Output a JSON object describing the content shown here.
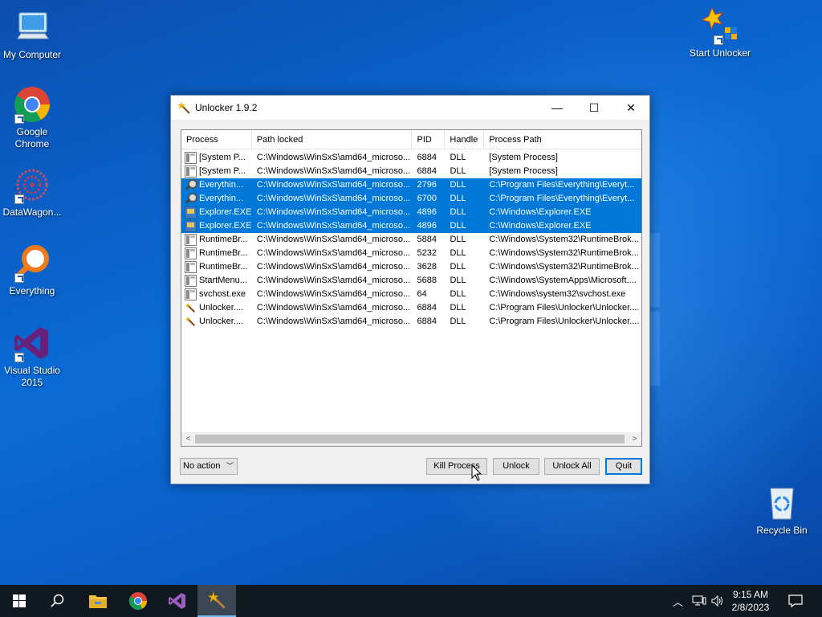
{
  "desktop": {
    "icons": [
      {
        "label": "My Computer"
      },
      {
        "label": "Google Chrome"
      },
      {
        "label": "DataWagon..."
      },
      {
        "label": "Everything"
      },
      {
        "label": "Visual Studio 2015"
      },
      {
        "label": "Start Unlocker"
      },
      {
        "label": "Recycle Bin"
      }
    ]
  },
  "window": {
    "title": "Unlocker 1.9.2",
    "controls": {
      "minimize": "—",
      "maximize": "☐",
      "close": "✕"
    },
    "columns": [
      "Process",
      "Path locked",
      "PID",
      "Handle",
      "Process Path"
    ],
    "rows": [
      {
        "process": "[System P...",
        "path": "C:\\Windows\\WinSxS\\amd64_microso...",
        "pid": "6884",
        "handle": "DLL",
        "ppath": "[System Process]",
        "icon": "process-icon",
        "selected": false
      },
      {
        "process": "[System P...",
        "path": "C:\\Windows\\WinSxS\\amd64_microso...",
        "pid": "6884",
        "handle": "DLL",
        "ppath": "[System Process]",
        "icon": "process-icon",
        "selected": false
      },
      {
        "process": "Everythin...",
        "path": "C:\\Windows\\WinSxS\\amd64_microso...",
        "pid": "2796",
        "handle": "DLL",
        "ppath": "C:\\Program Files\\Everything\\Everyt...",
        "icon": "magnifier-icon",
        "selected": true
      },
      {
        "process": "Everythin...",
        "path": "C:\\Windows\\WinSxS\\amd64_microso...",
        "pid": "6700",
        "handle": "DLL",
        "ppath": "C:\\Program Files\\Everything\\Everyt...",
        "icon": "magnifier-icon",
        "selected": true
      },
      {
        "process": "Explorer.EXE",
        "path": "C:\\Windows\\WinSxS\\amd64_microso...",
        "pid": "4896",
        "handle": "DLL",
        "ppath": "C:\\Windows\\Explorer.EXE",
        "icon": "explorer-icon",
        "selected": true
      },
      {
        "process": "Explorer.EXE",
        "path": "C:\\Windows\\WinSxS\\amd64_microso...",
        "pid": "4896",
        "handle": "DLL",
        "ppath": "C:\\Windows\\Explorer.EXE",
        "icon": "explorer-icon",
        "selected": true
      },
      {
        "process": "RuntimeBr...",
        "path": "C:\\Windows\\WinSxS\\amd64_microso...",
        "pid": "5884",
        "handle": "DLL",
        "ppath": "C:\\Windows\\System32\\RuntimeBrok...",
        "icon": "process-icon",
        "selected": false
      },
      {
        "process": "RuntimeBr...",
        "path": "C:\\Windows\\WinSxS\\amd64_microso...",
        "pid": "5232",
        "handle": "DLL",
        "ppath": "C:\\Windows\\System32\\RuntimeBrok...",
        "icon": "process-icon",
        "selected": false
      },
      {
        "process": "RuntimeBr...",
        "path": "C:\\Windows\\WinSxS\\amd64_microso...",
        "pid": "3628",
        "handle": "DLL",
        "ppath": "C:\\Windows\\System32\\RuntimeBrok...",
        "icon": "process-icon",
        "selected": false
      },
      {
        "process": "StartMenu...",
        "path": "C:\\Windows\\WinSxS\\amd64_microso...",
        "pid": "5688",
        "handle": "DLL",
        "ppath": "C:\\Windows\\SystemApps\\Microsoft....",
        "icon": "process-icon",
        "selected": false
      },
      {
        "process": "svchost.exe",
        "path": "C:\\Windows\\WinSxS\\amd64_microso...",
        "pid": "64",
        "handle": "DLL",
        "ppath": "C:\\Windows\\system32\\svchost.exe",
        "icon": "process-icon",
        "selected": false
      },
      {
        "process": "Unlocker....",
        "path": "C:\\Windows\\WinSxS\\amd64_microso...",
        "pid": "6884",
        "handle": "DLL",
        "ppath": "C:\\Program Files\\Unlocker\\Unlocker....",
        "icon": "wand-icon",
        "selected": false
      },
      {
        "process": "Unlocker....",
        "path": "C:\\Windows\\WinSxS\\amd64_microso...",
        "pid": "6884",
        "handle": "DLL",
        "ppath": "C:\\Program Files\\Unlocker\\Unlocker....",
        "icon": "wand-icon",
        "selected": false
      }
    ],
    "scroll_left": "<",
    "scroll_right": ">",
    "action_select": {
      "value": "No action",
      "chevron": "﹀"
    },
    "buttons": {
      "kill": "Kill Process",
      "unlock": "Unlock",
      "unlock_all": "Unlock All",
      "quit": "Quit"
    }
  },
  "taskbar": {
    "clock_time": "9:15 AM",
    "clock_date": "2/8/2023",
    "tray_chevron": "︿"
  },
  "colors": {
    "selection": "#0078d7",
    "taskbar": "#101820",
    "desktop": "#0a5fc4"
  }
}
